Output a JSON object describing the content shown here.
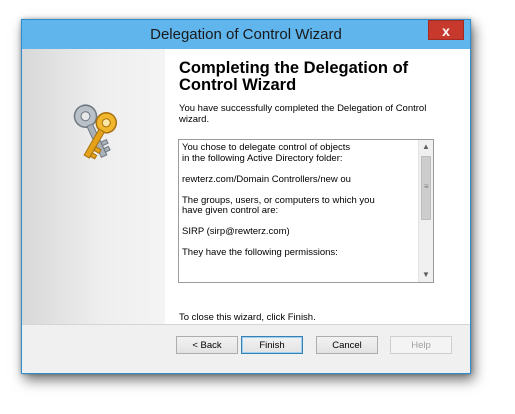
{
  "window": {
    "title": "Delegation of Control Wizard",
    "close_glyph": "x"
  },
  "content": {
    "title": "Completing the Delegation of Control Wizard",
    "intro": "You have successfully completed the Delegation of Control wizard.",
    "summary": "You chose to delegate control of objects\nin the following Active Directory folder:\n\n      rewterz.com/Domain Controllers/new ou\n\nThe groups, users, or computers to which you\nhave given control are:\n\n      SIRP (sirp@rewterz.com)\n\nThey have the following permissions:",
    "closing": "To close this wizard, click Finish."
  },
  "buttons": {
    "back": "< Back",
    "finish": "Finish",
    "cancel": "Cancel",
    "help": "Help"
  },
  "icons": {
    "side": "keys-icon",
    "scroll_up": "scroll-up-arrow-icon",
    "scroll_down": "scroll-down-arrow-icon"
  },
  "colors": {
    "titlebar": "#5fb5ec",
    "close": "#c7392c",
    "key_gold": "#e3a21a",
    "key_silver": "#a8b0b8"
  },
  "states": {
    "help_enabled": false,
    "default_button": "finish"
  }
}
